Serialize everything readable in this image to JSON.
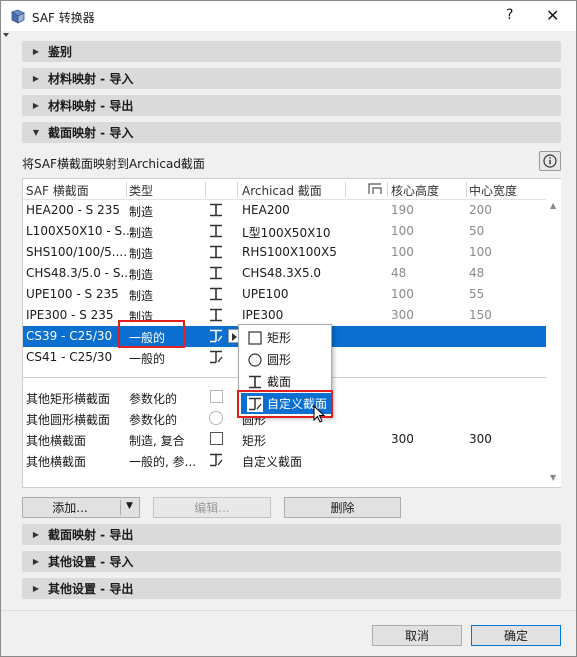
{
  "window": {
    "title": "SAF 转换器",
    "help_label": "?",
    "close_label": "✕"
  },
  "sections_top": [
    {
      "label": "鉴别",
      "expanded": false
    },
    {
      "label": "材料映射 - 导入",
      "expanded": false
    },
    {
      "label": "材料映射 - 导出",
      "expanded": false
    },
    {
      "label": "截面映射 - 导入",
      "expanded": true
    }
  ],
  "section_body": {
    "description": "将SAF横截面映射到Archicad截面",
    "info_icon": "info-icon"
  },
  "table": {
    "headers": [
      "SAF 横截面",
      "类型",
      "",
      "Archicad 截面",
      "",
      "核心高度",
      "中心宽度"
    ],
    "rows": [
      {
        "saf": "HEA200 - S 235",
        "type": "制造",
        "shape": "i-section",
        "archicad": "HEA200",
        "core": "190",
        "center": "200",
        "muted": true
      },
      {
        "saf": "L100X50X10 - S...",
        "type": "制造",
        "shape": "i-section",
        "archicad": "L型100X50X10",
        "core": "100",
        "center": "50",
        "muted": true
      },
      {
        "saf": "SHS100/100/5....",
        "type": "制造",
        "shape": "i-section",
        "archicad": "RHS100X100X5",
        "core": "100",
        "center": "100",
        "muted": true
      },
      {
        "saf": "CHS48.3/5.0 - S...",
        "type": "制造",
        "shape": "i-section",
        "archicad": "CHS48.3X5.0",
        "core": "48",
        "center": "48",
        "muted": true
      },
      {
        "saf": "UPE100 - S 235",
        "type": "制造",
        "shape": "i-section",
        "archicad": "UPE100",
        "core": "100",
        "center": "55",
        "muted": true
      },
      {
        "saf": "IPE300 - S 235",
        "type": "制造",
        "shape": "i-section",
        "archicad": "IPE300",
        "core": "300",
        "center": "150",
        "muted": true
      },
      {
        "saf": "CS39 - C25/30",
        "type": "一般的",
        "shape": "custom-section",
        "archicad": "",
        "core": "",
        "center": "",
        "selected": true
      },
      {
        "saf": "CS41 - C25/30",
        "type": "一般的",
        "shape": "custom-section",
        "archicad": "",
        "core": "",
        "center": ""
      }
    ],
    "other_rows": [
      {
        "saf": "其他矩形横截面",
        "type": "参数化的",
        "shape": "checkbox-light",
        "archicad": "",
        "core": "",
        "center": ""
      },
      {
        "saf": "其他圆形横截面",
        "type": "参数化的",
        "shape": "circle",
        "archicad": "圆形",
        "core": "",
        "center": ""
      },
      {
        "saf": "其他横截面",
        "type": "制造, 复合",
        "shape": "checkbox",
        "archicad": "矩形",
        "core": "300",
        "center": "300"
      },
      {
        "saf": "其他横截面",
        "type": "一般的, 参...",
        "shape": "custom-section",
        "archicad": "自定义截面",
        "core": "",
        "center": ""
      }
    ]
  },
  "dropdown": {
    "items": [
      {
        "label": "矩形",
        "icon": "rectangle-icon"
      },
      {
        "label": "圆形",
        "icon": "circle-icon"
      },
      {
        "label": "截面",
        "icon": "i-section-icon"
      },
      {
        "label": "自定义截面",
        "icon": "custom-section-icon",
        "highlighted": true
      }
    ]
  },
  "buttons": {
    "add": "添加...",
    "edit": "编辑...",
    "delete": "删除",
    "cancel": "取消",
    "ok": "确定"
  },
  "sections_bottom": [
    {
      "label": "截面映射 - 导出",
      "expanded": false
    },
    {
      "label": "其他设置 - 导入",
      "expanded": false
    },
    {
      "label": "其他设置 - 导出",
      "expanded": false
    }
  ],
  "colors": {
    "selection": "#0a6fd0",
    "highlight_box": "#e02020",
    "section_bar": "#dadada"
  }
}
